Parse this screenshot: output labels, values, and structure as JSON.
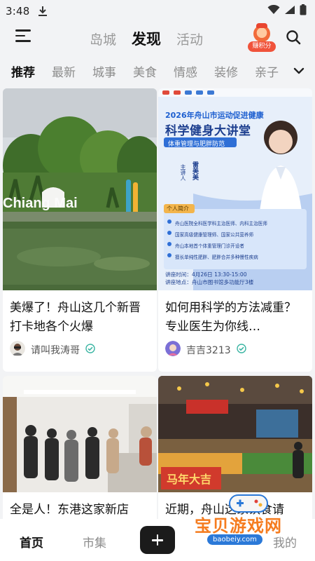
{
  "status_bar": {
    "time": "3:48"
  },
  "top_nav": {
    "tabs": [
      {
        "label": "岛城",
        "active": false
      },
      {
        "label": "发现",
        "active": true
      },
      {
        "label": "活动",
        "active": false
      }
    ],
    "points_badge": "赚积分"
  },
  "categories": [
    "推荐",
    "最新",
    "城事",
    "美食",
    "情感",
    "装修",
    "亲子"
  ],
  "feed": {
    "cards": [
      {
        "title": "美爆了！舟山这几个新晋打卡地各个火爆",
        "author": "请叫我涛哥",
        "verified": true,
        "image_sign": "Chiang Mai"
      },
      {
        "title": "如何用科学的方法减重？专业医生为你线…",
        "author": "吉吉3213",
        "verified": true,
        "poster": {
          "headline": "2026年舟山市运动促进健康",
          "title": "科学健身大讲堂",
          "topic": "体重管理与肥胖防范",
          "speaker_tag": "主讲人",
          "speaker_name": "雷美美",
          "intro_tag": "个人简介",
          "intro_lines": [
            "舟山医院全科医学科主治医师、内科主治医师",
            "国家高级健康管理师、国家公共营养师",
            "舟山本地首个体重管理门诊开设者",
            "擅长单纯性肥胖、肥胖合并多种慢性疾病"
          ],
          "time_line": "讲座时间：4月26日 13:30-15:00",
          "place_line": "讲座地点：舟山市图书馆多功能厅3楼"
        }
      },
      {
        "title": "全是人！东港这家新店",
        "author": "",
        "verified": false
      },
      {
        "title": "近期，舟山这家饮食请",
        "author": "",
        "verified": false,
        "image_sign": "马年大吉"
      }
    ]
  },
  "bottom_bar": {
    "home": "首页",
    "market": "市集",
    "mine": "我的"
  },
  "watermark": {
    "text": "宝贝游戏网",
    "url": "baobeiy.com"
  },
  "colors": {
    "accent": "#f0533b",
    "verify": "#3bb5a3",
    "poster_blue": "#1d5fd0",
    "watermark": "#f57c1f"
  }
}
